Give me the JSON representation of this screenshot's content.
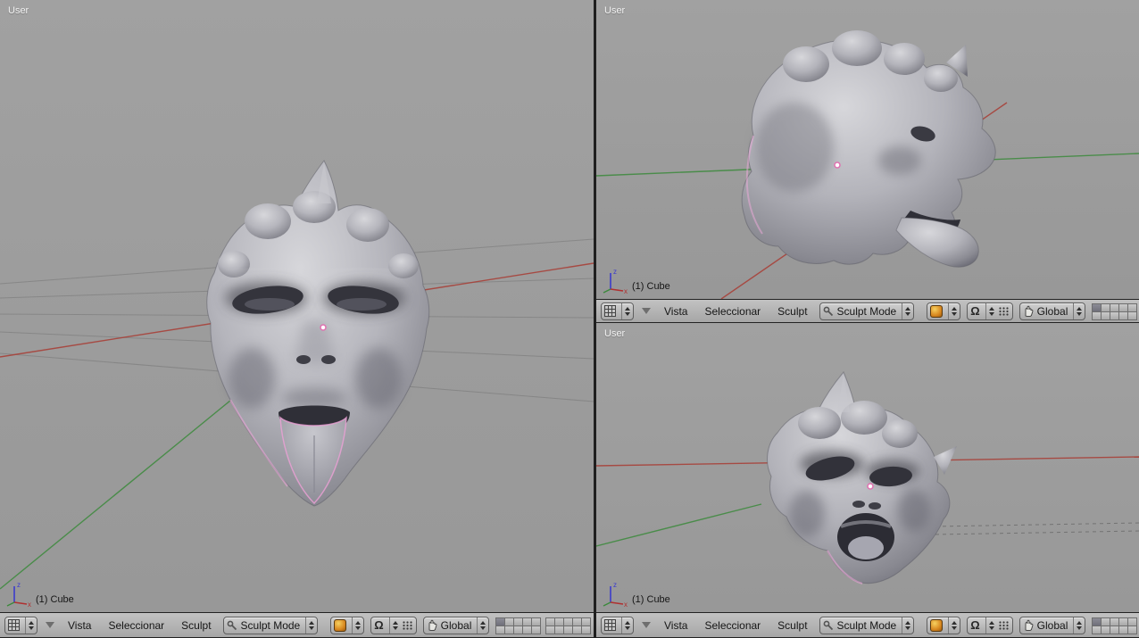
{
  "viewport": {
    "view_label": "User",
    "object_label": "(1) Cube"
  },
  "header": {
    "menus": [
      "Vista",
      "Seleccionar",
      "Sculpt"
    ],
    "mode_value": "Sculpt Mode",
    "orientation_value": "Global",
    "layers": {
      "count_per_block": 10,
      "blocks": 2,
      "active": 0
    }
  },
  "icons": {
    "magnet_glyph": "Ω"
  },
  "colors": {
    "viewport_bg": "#9c9c9c",
    "header_bg": "#b4b4b4",
    "axis_x": "#a8423a",
    "axis_y": "#3c8a3c",
    "axis_z": "#3c3ccc",
    "selection_outline": "#e8a0d0"
  }
}
